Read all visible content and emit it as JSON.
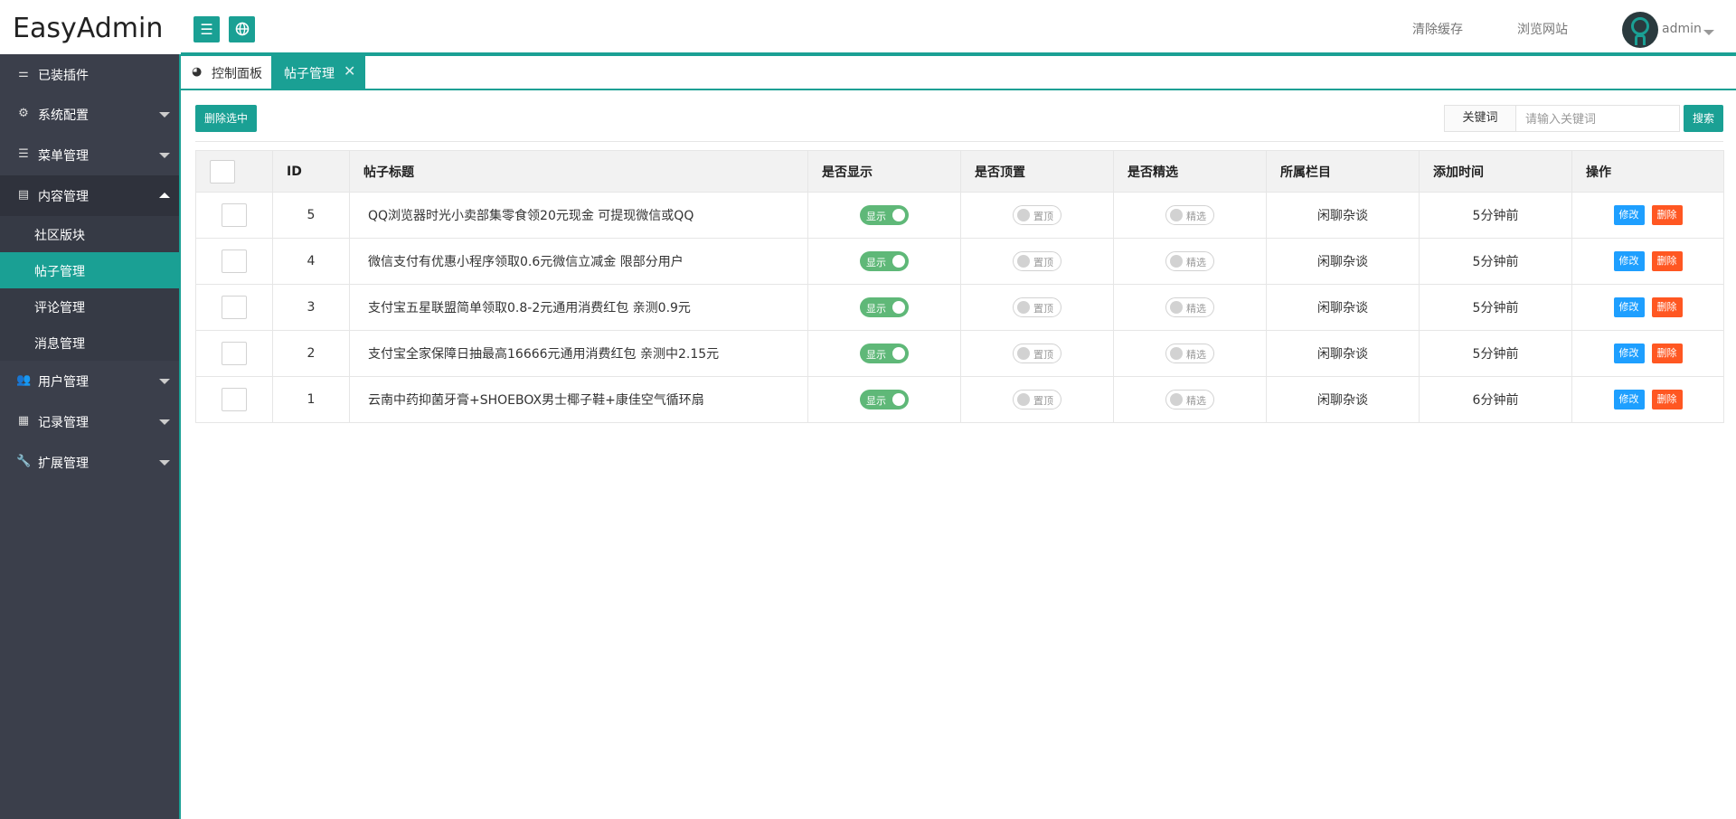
{
  "header": {
    "logo": "EasyAdmin",
    "clear_cache": "清除缓存",
    "browse_site": "浏览网站",
    "username": "admin"
  },
  "sidebar": {
    "items": [
      {
        "label": "已装插件",
        "icon": "sliders-icon"
      },
      {
        "label": "系统配置",
        "icon": "gears-icon"
      },
      {
        "label": "菜单管理",
        "icon": "bars-icon"
      },
      {
        "label": "内容管理",
        "icon": "file-icon"
      },
      {
        "label": "用户管理",
        "icon": "users-icon"
      },
      {
        "label": "记录管理",
        "icon": "grid-icon"
      },
      {
        "label": "扩展管理",
        "icon": "wrench-icon"
      }
    ],
    "subitems": [
      {
        "label": "社区版块"
      },
      {
        "label": "帖子管理"
      },
      {
        "label": "评论管理"
      },
      {
        "label": "消息管理"
      }
    ]
  },
  "tabs": {
    "home": "控制面板",
    "active": "帖子管理",
    "close": "✕"
  },
  "toolbar": {
    "delete_selected": "删除选中",
    "keyword_label": "关键词",
    "keyword_placeholder": "请输入关键词",
    "search": "搜索"
  },
  "table": {
    "columns": [
      "ID",
      "帖子标题",
      "是否显示",
      "是否顶置",
      "是否精选",
      "所属栏目",
      "添加时间",
      "操作"
    ],
    "rows": [
      {
        "id": "5",
        "title": "QQ浏览器时光小卖部集零食领20元现金 可提现微信或QQ",
        "show": "显示",
        "top": "置顶",
        "featured": "精选",
        "category": "闲聊杂谈",
        "time": "5分钟前",
        "edit": "修改",
        "delete": "删除"
      },
      {
        "id": "4",
        "title": "微信支付有优惠小程序领取0.6元微信立减金 限部分用户",
        "show": "显示",
        "top": "置顶",
        "featured": "精选",
        "category": "闲聊杂谈",
        "time": "5分钟前",
        "edit": "修改",
        "delete": "删除"
      },
      {
        "id": "3",
        "title": "支付宝五星联盟简单领取0.8-2元通用消费红包 亲测0.9元",
        "show": "显示",
        "top": "置顶",
        "featured": "精选",
        "category": "闲聊杂谈",
        "time": "5分钟前",
        "edit": "修改",
        "delete": "删除"
      },
      {
        "id": "2",
        "title": "支付宝全家保障日抽最高16666元通用消费红包 亲测中2.15元",
        "show": "显示",
        "top": "置顶",
        "featured": "精选",
        "category": "闲聊杂谈",
        "time": "5分钟前",
        "edit": "修改",
        "delete": "删除"
      },
      {
        "id": "1",
        "title": "云南中药抑菌牙膏+SHOEBOX男士椰子鞋+康佳空气循环扇",
        "show": "显示",
        "top": "置顶",
        "featured": "精选",
        "category": "闲聊杂谈",
        "time": "6分钟前",
        "edit": "修改",
        "delete": "删除"
      }
    ]
  },
  "colors": {
    "accent": "#1aa094",
    "sidebar_bg": "#3b3f4b",
    "switch_on": "#5fb878",
    "edit_button": "#1e9fff",
    "delete_button": "#ff5722"
  }
}
